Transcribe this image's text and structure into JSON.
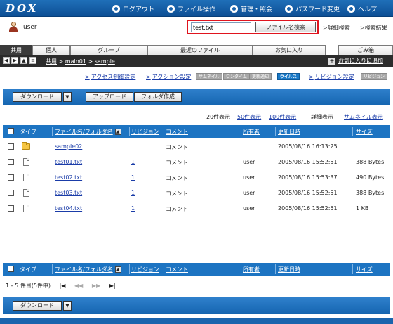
{
  "app": {
    "logo": "DOX"
  },
  "header": {
    "nav": [
      {
        "label": "ログアウト",
        "icon": "logout-icon"
      },
      {
        "label": "ファイル操作",
        "icon": "file-operation-icon"
      },
      {
        "label": "管理・照会",
        "icon": "admin-icon"
      },
      {
        "label": "パスワード変更",
        "icon": "password-change-icon"
      },
      {
        "label": "ヘルプ",
        "icon": "help-icon"
      }
    ]
  },
  "user": {
    "name": "user"
  },
  "search": {
    "value": "test.txt",
    "button_label": "ファイル名検索",
    "advanced_label": "詳細検索",
    "results_label": "検索結果"
  },
  "tabs": [
    {
      "label": "共用",
      "active": true
    },
    {
      "label": "個人"
    },
    {
      "label": "グループ"
    },
    {
      "label": "最近のファイル"
    },
    {
      "label": "お気に入り"
    },
    {
      "label": "ごみ箱"
    }
  ],
  "breadcrumb": {
    "items": [
      "共用",
      "main01",
      "sample"
    ],
    "separator": ">"
  },
  "favorite_add_label": "お気に入りに追加",
  "settings": {
    "access_label": "アクセス制御設定",
    "action_label": "アクション設定",
    "pills": [
      "サムネイル",
      "ワンタイム",
      "更新通知",
      "ウイルス"
    ],
    "revision_label": "リビジョン設定",
    "revision_pill": "リビジョン"
  },
  "toolbar": {
    "download_label": "ダウンロード",
    "upload_label": "アップロード",
    "folder_create_label": "フォルダ作成"
  },
  "view": {
    "label_20": "20件表示",
    "label_50": "50件表示",
    "label_100": "100件表示",
    "separator": "|",
    "detail_label": "詳細表示",
    "thumbnail_label": "サムネイル表示"
  },
  "table": {
    "headers": {
      "type": "タイプ",
      "name": "ファイル名/フォルダ名",
      "revision": "リビジョン",
      "comment": "コメント",
      "owner": "所有者",
      "updated": "更新日時",
      "size": "サイズ"
    },
    "rows": [
      {
        "kind": "folder",
        "name": "sample02",
        "revision": "",
        "comment": "コメント",
        "owner": "",
        "updated": "2005/08/16 16:13:25",
        "size": ""
      },
      {
        "kind": "file",
        "name": "test01.txt",
        "revision": "1",
        "comment": "コメント",
        "owner": "user",
        "updated": "2005/08/16 15:52:51",
        "size": "388 Bytes"
      },
      {
        "kind": "file",
        "name": "test02.txt",
        "revision": "1",
        "comment": "コメント",
        "owner": "user",
        "updated": "2005/08/16 15:53:37",
        "size": "490 Bytes"
      },
      {
        "kind": "file",
        "name": "test03.txt",
        "revision": "1",
        "comment": "コメント",
        "owner": "user",
        "updated": "2005/08/16 15:52:51",
        "size": "388 Bytes"
      },
      {
        "kind": "file",
        "name": "test04.txt",
        "revision": "1",
        "comment": "コメント",
        "owner": "user",
        "updated": "2005/08/16 15:52:51",
        "size": "1 KB"
      }
    ]
  },
  "pager": {
    "summary": "1 - 5 件目(5件中)",
    "first": "|◀",
    "prev": "◀◀",
    "next": "▶▶",
    "last": "▶|"
  },
  "colors": {
    "header_blue": "#1a64ad",
    "highlight_red": "#e0141e",
    "table_header": "#1d74c2"
  }
}
